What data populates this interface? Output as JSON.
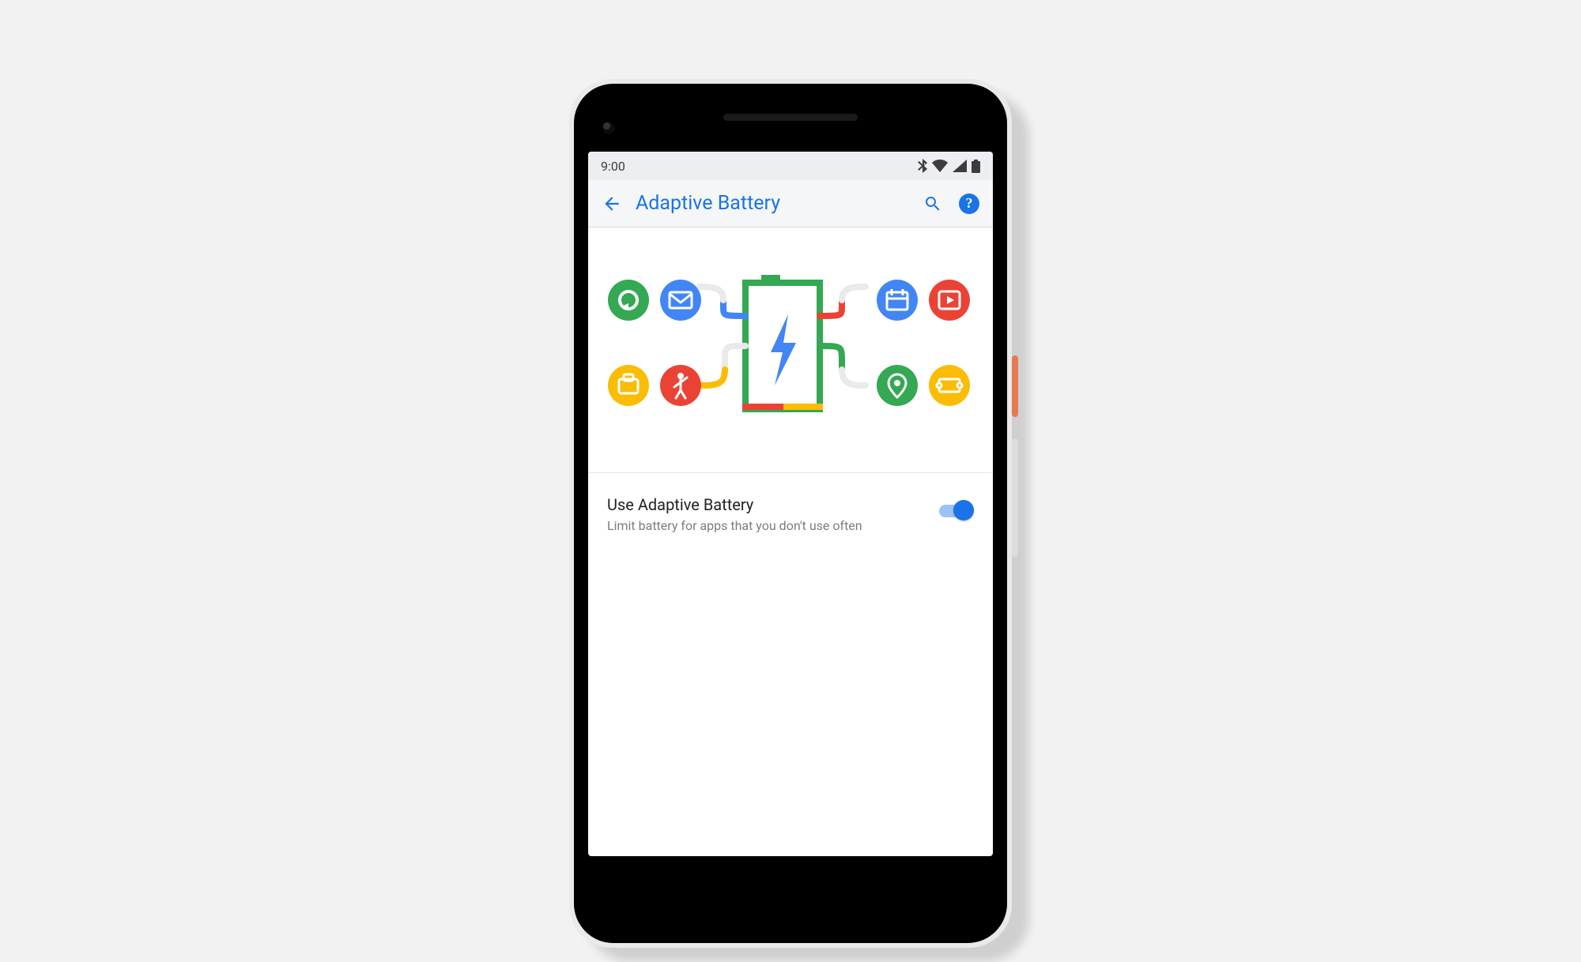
{
  "status_bar": {
    "time": "9:00"
  },
  "app_bar": {
    "title": "Adaptive Battery"
  },
  "setting": {
    "title": "Use Adaptive Battery",
    "subtitle": "Limit battery for apps that you don't use often",
    "enabled": true
  },
  "colors": {
    "accent": "#1a73e8",
    "google_green": "#34a853",
    "google_blue": "#4285f4",
    "google_yellow": "#fbbc04",
    "google_red": "#ea4335"
  }
}
